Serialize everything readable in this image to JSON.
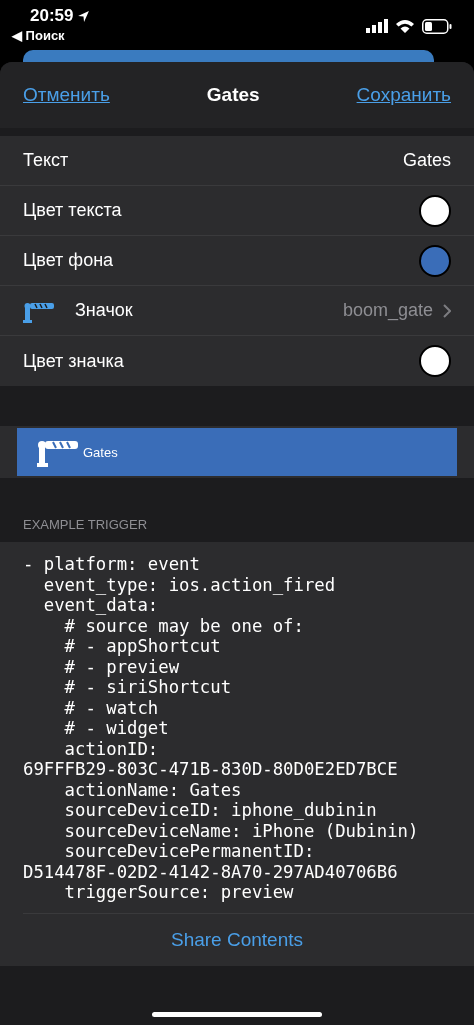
{
  "status_bar": {
    "time": "20:59",
    "back_label": "◀ Поиск"
  },
  "header": {
    "cancel": "Отменить",
    "title": "Gates",
    "save": "Сохранить"
  },
  "rows": [
    {
      "kind": "text",
      "label": "Текст",
      "value": "Gates"
    },
    {
      "kind": "color",
      "label": "Цвет текста",
      "color": "#ffffff"
    },
    {
      "kind": "color",
      "label": "Цвет фона",
      "color": "#3a6db8"
    },
    {
      "kind": "icon",
      "label": "Значок",
      "value": "boom_gate"
    },
    {
      "kind": "color",
      "label": "Цвет значка",
      "color": "#ffffff"
    }
  ],
  "preview": {
    "label": "Gates"
  },
  "example": {
    "heading": "EXAMPLE TRIGGER",
    "code_lines": [
      "- platform: event",
      "  event_type: ios.action_fired",
      "  event_data:",
      "    # source may be one of:",
      "    # - appShortcut",
      "    # - preview",
      "    # - siriShortcut",
      "    # - watch",
      "    # - widget",
      "    actionID:",
      "69FFFB29-803C-471B-830D-80D0E2ED7BCE",
      "    actionName: Gates",
      "    sourceDeviceID: iphone_dubinin",
      "    sourceDeviceName: iPhone (Dubinin)",
      "    sourceDevicePermanentID:",
      "D514478F-02D2-4142-8A70-297AD40706B6",
      "    triggerSource: preview"
    ],
    "share": "Share Contents"
  }
}
